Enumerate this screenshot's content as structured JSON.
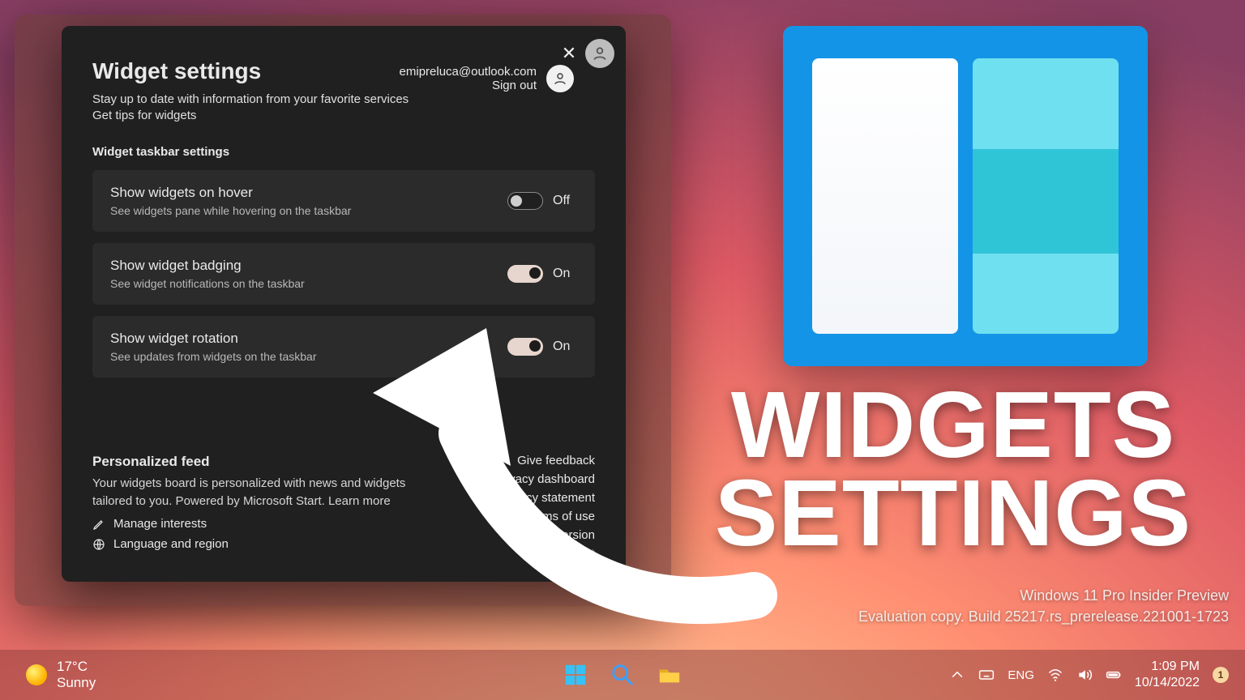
{
  "dialog": {
    "title": "Widget settings",
    "subtitle": "Stay up to date with information from your favorite services",
    "tips_link": "Get tips for widgets",
    "account": {
      "email": "emipreluca@outlook.com",
      "signout": "Sign out"
    },
    "section_label": "Widget taskbar settings",
    "settings": [
      {
        "title": "Show widgets on hover",
        "desc": "See widgets pane while hovering on the taskbar",
        "on": false,
        "state": "Off"
      },
      {
        "title": "Show widget badging",
        "desc": "See widget notifications on the taskbar",
        "on": true,
        "state": "On"
      },
      {
        "title": "Show widget rotation",
        "desc": "See updates from widgets on the taskbar",
        "on": true,
        "state": "On"
      }
    ],
    "feed": {
      "heading": "Personalized feed",
      "body": "Your widgets board is personalized with news and widgets tailored to you. Powered by Microsoft Start. Learn more",
      "manage": "Manage interests",
      "lang": "Language and region"
    },
    "right_links": {
      "feedback": "Give feedback",
      "privacy_dash": "Privacy dashboard",
      "privacy_stmt": "Privacy statement",
      "terms": "Terms of use",
      "version_label": "Version",
      "version": "521.*"
    }
  },
  "promo": {
    "line1": "WIDGETS",
    "line2": "SETTINGS"
  },
  "watermark": {
    "line1": "Windows 11 Pro Insider Preview",
    "line2": "Evaluation copy. Build 25217.rs_prerelease.221001-1723"
  },
  "taskbar": {
    "weather": {
      "temp": "17°C",
      "cond": "Sunny"
    },
    "lang": "ENG",
    "time": "1:09 PM",
    "date": "10/14/2022",
    "notif_count": "1"
  }
}
